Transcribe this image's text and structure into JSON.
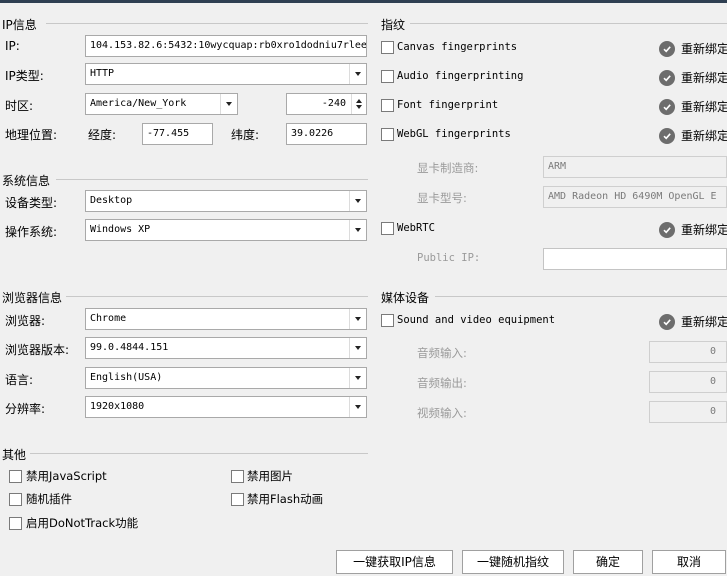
{
  "ip_info": {
    "title": "IP信息",
    "ip_label": "IP:",
    "ip_value": "104.153.82.6:5432:10wycquap:rb0xro1dodniu7rlee",
    "ip_type_label": "IP类型:",
    "ip_type_value": "HTTP",
    "timezone_label": "时区:",
    "timezone_value": "America/New_York",
    "timezone_offset": "-240",
    "geo_label": "地理位置:",
    "longitude_label": "经度:",
    "longitude_value": "-77.455",
    "latitude_label": "纬度:",
    "latitude_value": "39.0226"
  },
  "system_info": {
    "title": "系统信息",
    "device_type_label": "设备类型:",
    "device_type_value": "Desktop",
    "os_label": "操作系统:",
    "os_value": "Windows XP"
  },
  "browser_info": {
    "title": "浏览器信息",
    "browser_label": "浏览器:",
    "browser_value": "Chrome",
    "version_label": "浏览器版本:",
    "version_value": "99.0.4844.151",
    "language_label": "语言:",
    "language_value": "English(USA)",
    "resolution_label": "分辨率:",
    "resolution_value": "1920x1080"
  },
  "other": {
    "title": "其他",
    "disable_js": "禁用JavaScript",
    "disable_images": "禁用图片",
    "random_plugins": "随机插件",
    "disable_flash": "禁用Flash动画",
    "enable_dnt": "启用DoNotTrack功能"
  },
  "fingerprint": {
    "title": "指纹",
    "canvas": "Canvas fingerprints",
    "audio": "Audio fingerprinting",
    "font": "Font fingerprint",
    "webgl": "WebGL fingerprints",
    "gpu_vendor_label": "显卡制造商:",
    "gpu_vendor_value": "ARM",
    "gpu_model_label": "显卡型号:",
    "gpu_model_value": "AMD Radeon HD 6490M OpenGL E",
    "webrtc": "WebRTC",
    "public_ip_label": "Public IP:",
    "public_ip_value": "",
    "rebind_label": "重新绑定"
  },
  "media": {
    "title": "媒体设备",
    "sound_video": "Sound and video equipment",
    "audio_in_label": "音频输入:",
    "audio_in_value": "0",
    "audio_out_label": "音频输出:",
    "audio_out_value": "0",
    "video_in_label": "视频输入:",
    "video_in_value": "0"
  },
  "buttons": {
    "get_ip": "一键获取IP信息",
    "random_fp": "一键随机指纹",
    "ok": "确定",
    "cancel": "取消"
  },
  "icons": {
    "check_circle": "check-circle-icon",
    "dropdown": "chevron-down-icon",
    "spin": "spinner-arrows-icon"
  }
}
